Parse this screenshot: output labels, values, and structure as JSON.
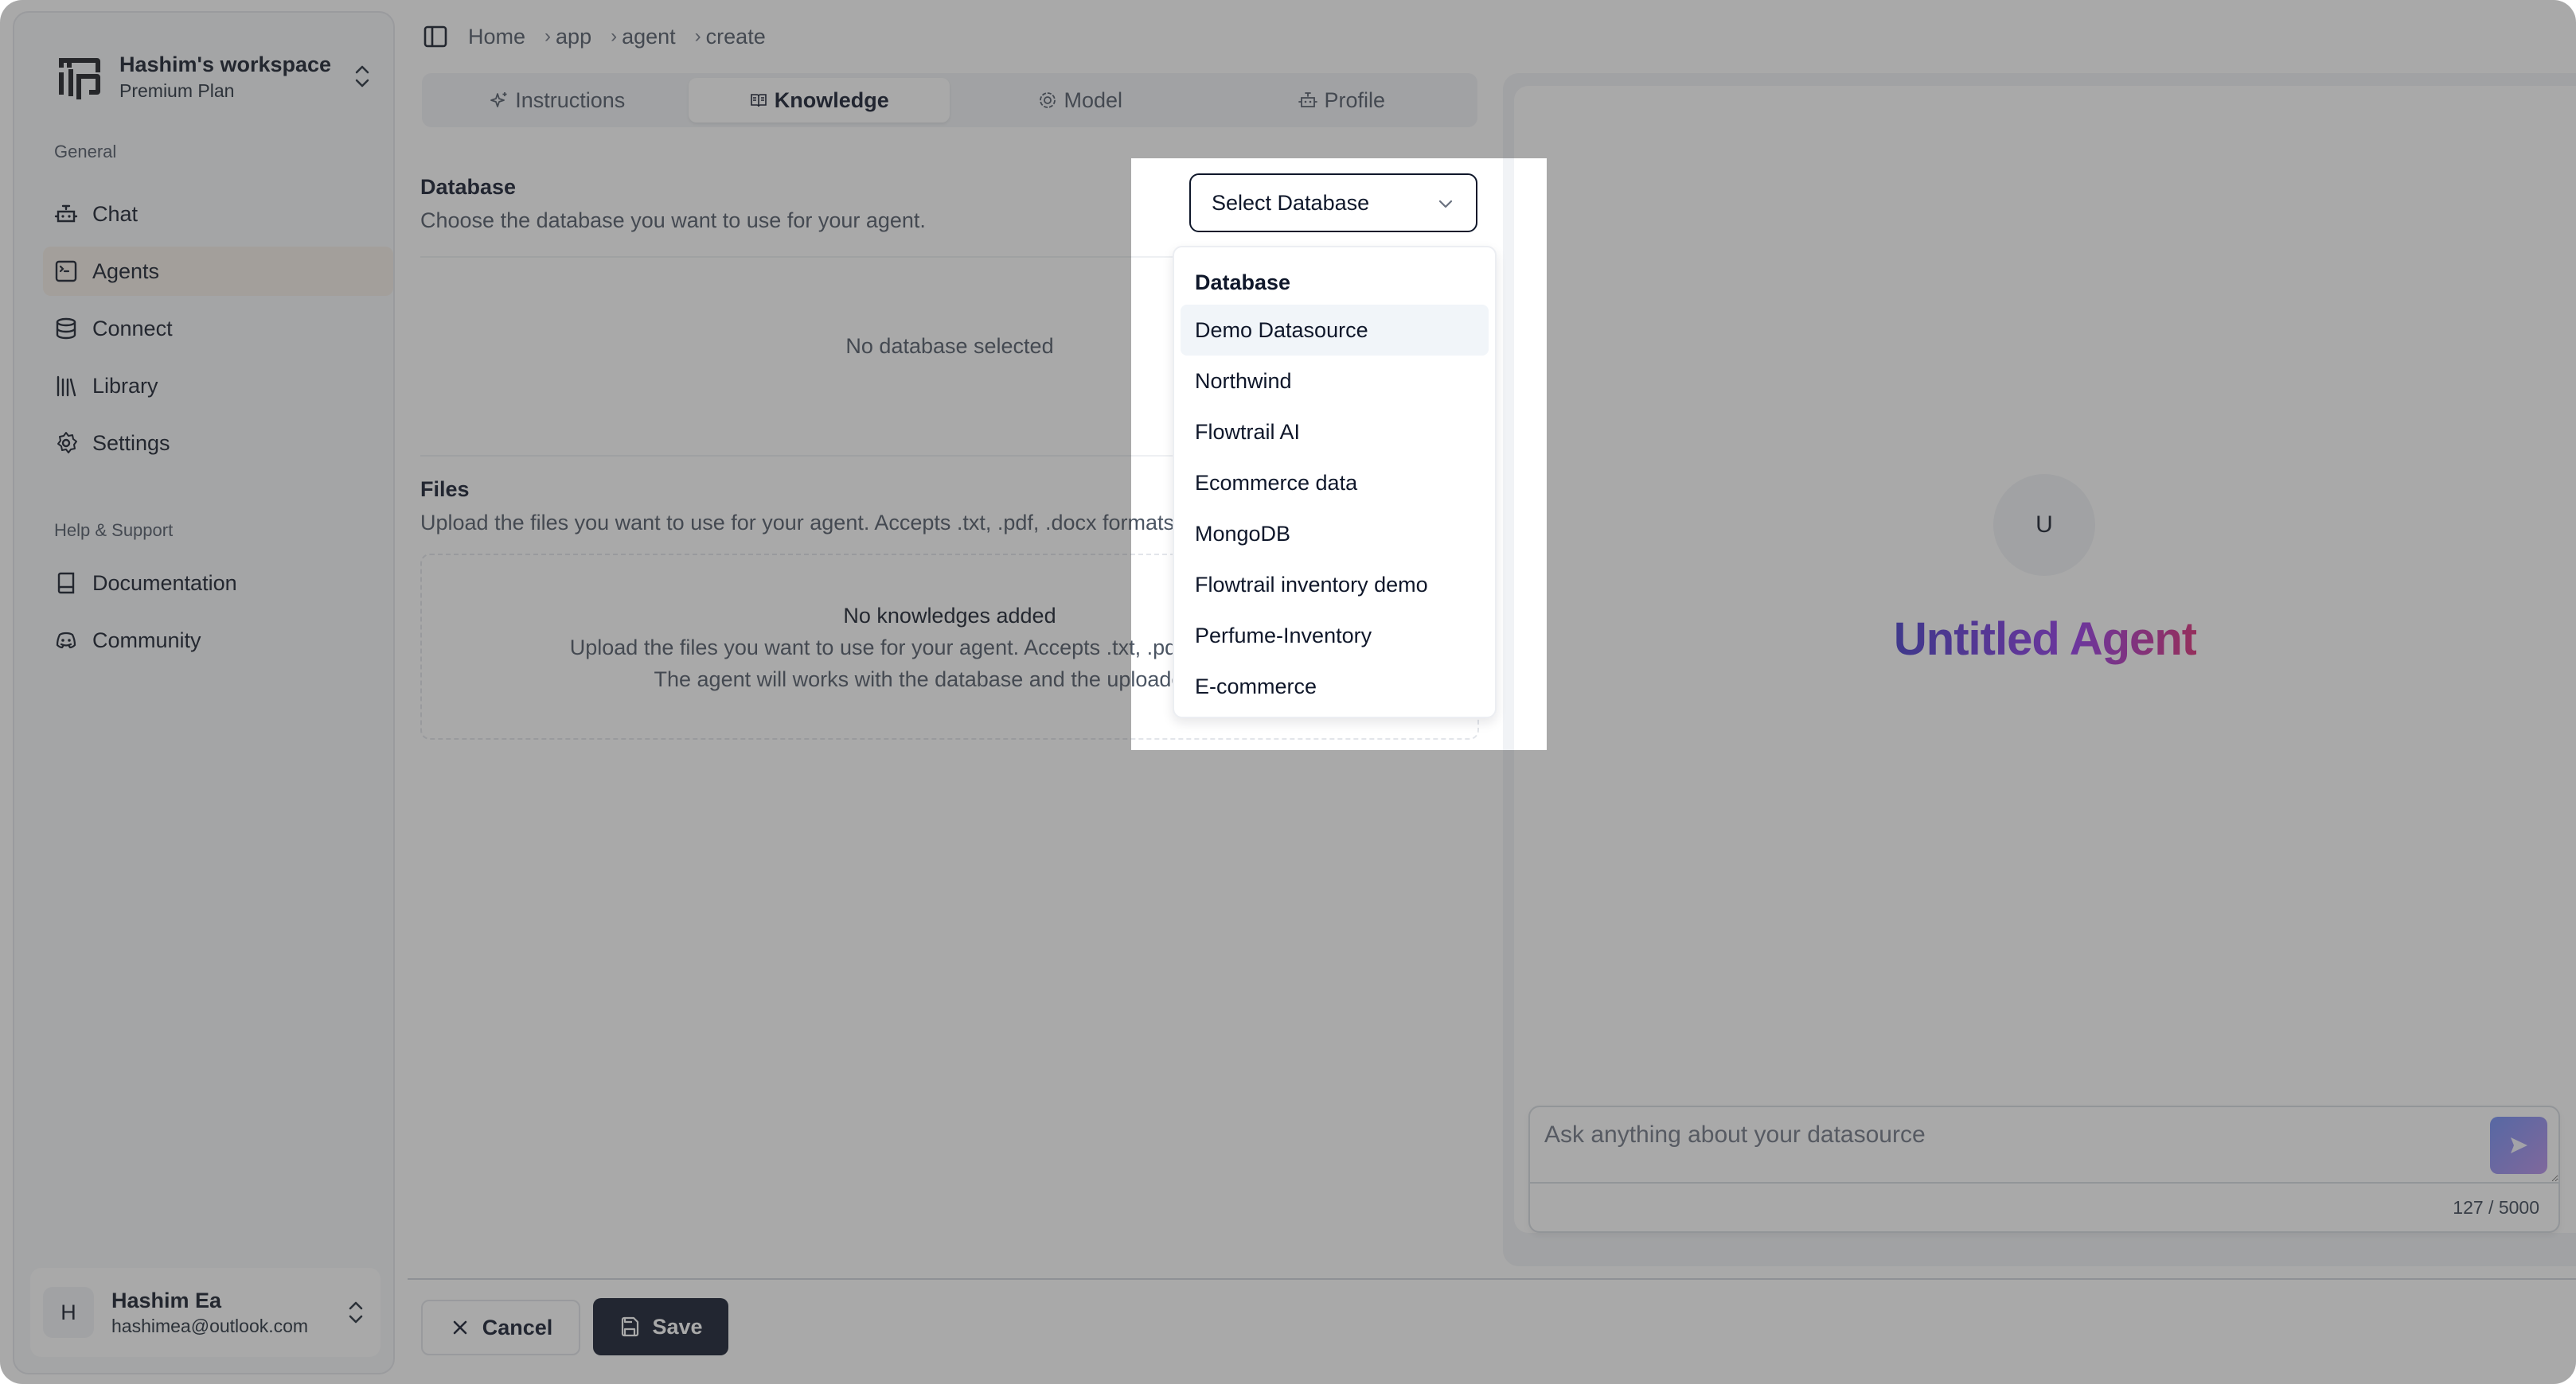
{
  "workspace": {
    "name": "Hashim's workspace",
    "plan": "Premium Plan"
  },
  "sidebar": {
    "general_label": "General",
    "general_items": [
      {
        "label": "Chat",
        "icon": "bot-icon"
      },
      {
        "label": "Agents",
        "icon": "terminal-square-icon",
        "active": true
      },
      {
        "label": "Connect",
        "icon": "database-icon"
      },
      {
        "label": "Library",
        "icon": "library-icon"
      },
      {
        "label": "Settings",
        "icon": "gear-icon"
      }
    ],
    "help_label": "Help & Support",
    "help_items": [
      {
        "label": "Documentation",
        "icon": "book-icon"
      },
      {
        "label": "Community",
        "icon": "discord-icon"
      }
    ],
    "user": {
      "initial": "H",
      "name": "Hashim Ea",
      "email": "hashimea@outlook.com"
    }
  },
  "breadcrumb": [
    "Home",
    "app",
    "agent",
    "create"
  ],
  "tabs": [
    {
      "label": "Instructions",
      "icon": "sparkles-icon"
    },
    {
      "label": "Knowledge",
      "icon": "book-open-icon",
      "active": true
    },
    {
      "label": "Model",
      "icon": "model-icon"
    },
    {
      "label": "Profile",
      "icon": "bot-icon"
    }
  ],
  "database": {
    "title": "Database",
    "description": "Choose the database you want to use for your agent.",
    "empty": "No database selected",
    "select_placeholder": "Select Database",
    "menu_label": "Database",
    "options": [
      "Demo Datasource",
      "Northwind",
      "Flowtrail AI",
      "Ecommerce data",
      "MongoDB",
      "Flowtrail inventory demo",
      "Perfume-Inventory",
      "E-commerce"
    ],
    "highlighted_option": "Demo Datasource"
  },
  "files": {
    "title": "Files",
    "description": "Upload the files you want to use for your agent. Accepts .txt, .pdf, .docx formats.",
    "empty_title": "No knowledges added",
    "empty_line1": "Upload the files you want to use for your agent. Accepts .txt, .pdf, .docx formats.",
    "empty_line2": "The agent will works with the database and the uploaded files."
  },
  "preview": {
    "avatar_initial": "U",
    "agent_name": "Untitled Agent",
    "input_placeholder": "Ask anything about your datasource",
    "counter": "127 / 5000"
  },
  "footer": {
    "cancel_label": "Cancel",
    "save_label": "Save"
  },
  "colors": {
    "primary": "#0f172a",
    "title_gradient_start": "#4338ca",
    "title_gradient_end": "#db2777",
    "active_nav": "#f4eee6"
  }
}
